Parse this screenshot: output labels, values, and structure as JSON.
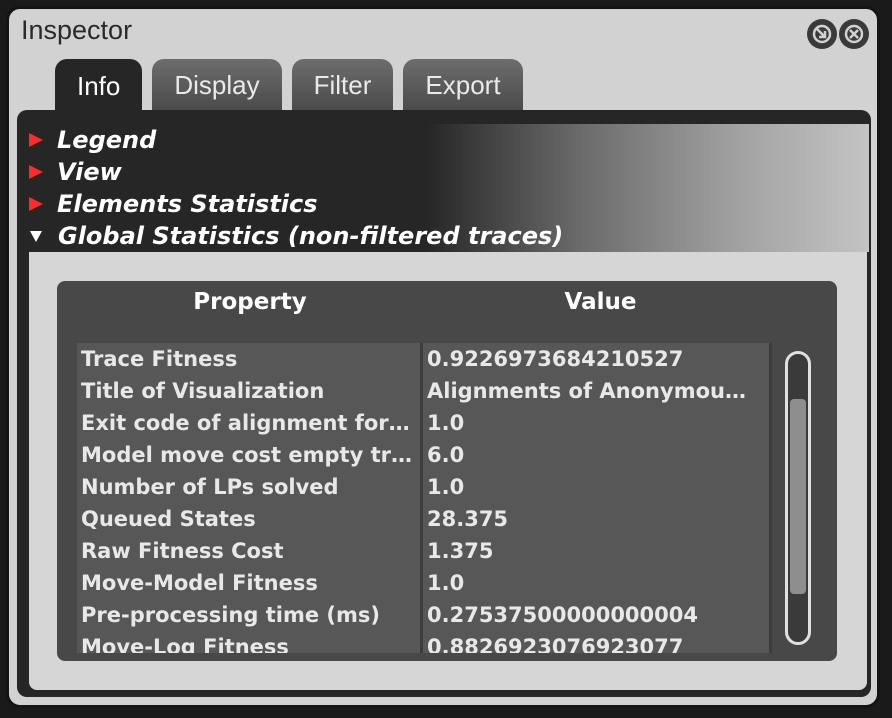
{
  "window": {
    "title": "Inspector"
  },
  "tabs": [
    "Info",
    "Display",
    "Filter",
    "Export"
  ],
  "active_tab": "Info",
  "sections": [
    {
      "label": "Legend",
      "expanded": false
    },
    {
      "label": "View",
      "expanded": false
    },
    {
      "label": "Elements Statistics",
      "expanded": false
    },
    {
      "label": "Global Statistics (non-filtered traces)",
      "expanded": true
    }
  ],
  "table": {
    "headers": [
      "Property",
      "Value"
    ],
    "rows": [
      [
        "Trace Fitness",
        "0.9226973684210527"
      ],
      [
        "Title of Visualization",
        "Alignments of Anonymou…"
      ],
      [
        "Exit code of alignment for…",
        "1.0"
      ],
      [
        "Model move cost empty tr…",
        "6.0"
      ],
      [
        "Number of LPs solved",
        "1.0"
      ],
      [
        "Queued States",
        "28.375"
      ],
      [
        "Raw Fitness Cost",
        "1.375"
      ],
      [
        "Move-Model Fitness",
        "1.0"
      ],
      [
        "Pre-processing time (ms)",
        "0.27537500000000004"
      ],
      [
        "Move-Log Fitness",
        "0.8826923076923077"
      ]
    ]
  },
  "colors": {
    "expander_arrow": "#ff2a2a",
    "panel_bg": "#262626",
    "table_bg": "#484848"
  },
  "icons": {
    "window_buttons": [
      "detach-icon",
      "close-panel-icon"
    ]
  }
}
